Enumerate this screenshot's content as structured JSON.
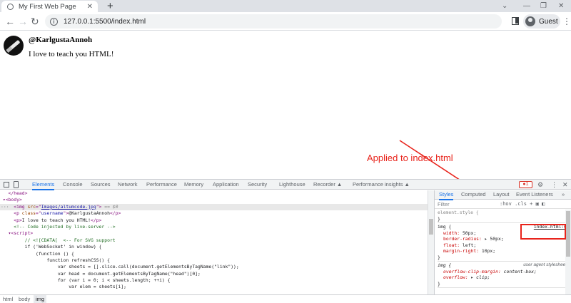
{
  "browser": {
    "tab_title": "My First Web Page",
    "url": "127.0.0.1:5500/index.html",
    "profile_label": "Guest"
  },
  "page": {
    "username": "@KarlgustaAnnoh",
    "bio": "I love to teach you HTML!"
  },
  "annotation": {
    "text": "Applied to index.html",
    "color": "#e8231b"
  },
  "devtools": {
    "tabs": [
      "Elements",
      "Console",
      "Sources",
      "Network",
      "Performance",
      "Memory",
      "Application",
      "Security",
      "Lighthouse",
      "Recorder ▲",
      "Performance insights ▲"
    ],
    "active_tab": "Elements",
    "error_count": "1",
    "dom": {
      "head_close": "</head>",
      "body_open": "<body>",
      "img_src": "Images/altumcode.jpg",
      "img_eq": "== $0",
      "p_username": "@KarlgustaAnnoh",
      "p_bio": "I love to teach you HTML!",
      "comment_ls": "<!-- Code injected by live-server -->",
      "script_open": "<script>",
      "cdata": "// <![CDATA[  <-- For SVG support",
      "js_if": "if ('WebSocket' in window) {",
      "js_fn": "(function () {",
      "js_refresh": "function refreshCSS() {",
      "js_sheets": "var sheets = [].slice.call(document.getElementsByTagName(\"link\"));",
      "js_head": "var head = document.getElementsByTagName(\"head\")[0];",
      "js_for": "for (var i = 0; i < sheets.length; ++i) {",
      "js_elem": "var elem = sheets[i];"
    },
    "styles_tabs": [
      "Styles",
      "Computed",
      "Layout",
      "Event Listeners",
      "»"
    ],
    "filter_placeholder": "Filter",
    "filter_tools": ":hov .cls + ▣ ◧",
    "element_style": "element.style {",
    "rule1": {
      "selector": "img {",
      "source": "index.html:6",
      "props": [
        {
          "name": "width",
          "value": "50px;"
        },
        {
          "name": "border-radius",
          "value": "▸ 50px;"
        },
        {
          "name": "float",
          "value": "left;"
        },
        {
          "name": "margin-right",
          "value": "10px;"
        }
      ]
    },
    "rule2": {
      "selector": "img {",
      "source": "user agent stylesheet",
      "props": [
        {
          "name": "overflow-clip-margin",
          "value": "content-box;"
        },
        {
          "name": "overflow",
          "value": "▸ clip;"
        }
      ]
    },
    "breadcrumb": [
      "html",
      "body",
      "img"
    ]
  }
}
